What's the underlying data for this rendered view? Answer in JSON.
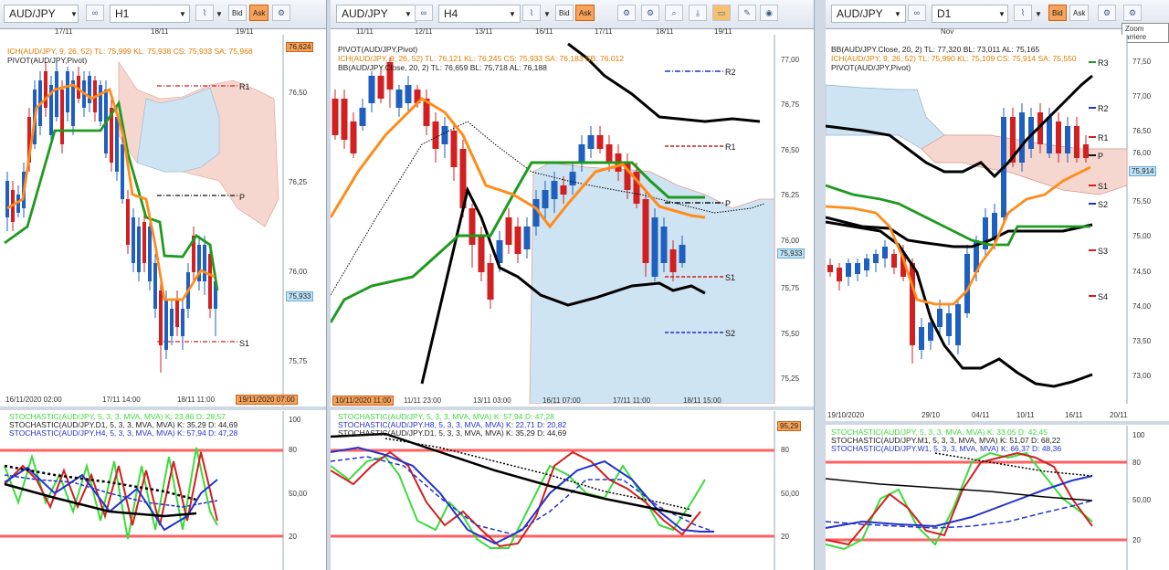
{
  "panels": [
    {
      "symbol": "AUD/JPY",
      "timeframe": "H1",
      "bid_label": "Bid",
      "ask_label": "Ask",
      "indicators": [
        {
          "text": "ICH(AUD/JPY, 9, 26, 52)  TL: 75,999  KL: 75,938  CS: 75,933  SA: 75,968",
          "color": "#e07b00"
        },
        {
          "text": "PIVOT(AUD/JPY,Pivot)",
          "color": "#222222"
        }
      ],
      "top_dates": [
        "17/11",
        "18/11",
        "19/11"
      ],
      "price_labels": [
        "76,50",
        "76,25",
        "76,00",
        "75,75"
      ],
      "price_top_tag": "76,624",
      "current_price": "75,933",
      "pivot_labels": [
        "R1",
        "P",
        "S1"
      ],
      "bottom_dates": [
        "16/11/2020 02:00",
        "17/11 14:00",
        "18/11 11:00"
      ],
      "bottom_tag": "19/11/2020 07:00",
      "stoch_lines": [
        {
          "text": "STOCHASTIC(AUD/JPY, 5, 3, 3, MVA, MVA)   K: 23,86   D: 28,57",
          "color": "#3cdc3c"
        },
        {
          "text": "STOCHASTIC(AUD/JPY.D1, 5, 3, 3, MVA, MVA)   K: 35,29   D: 44,69",
          "color": "#222222"
        },
        {
          "text": "STOCHASTIC(AUD/JPY.H4, 5, 3, 3, MVA, MVA)   K: 57,94   D: 47,28",
          "color": "#2233cc"
        }
      ],
      "stoch_axis": [
        "100",
        "80",
        "50,00",
        "20"
      ]
    },
    {
      "symbol": "AUD/JPY",
      "timeframe": "H4",
      "bid_label": "Bid",
      "ask_label": "Ask",
      "indicators": [
        {
          "text": "PIVOT(AUD/JPY,Pivot)",
          "color": "#222222"
        },
        {
          "text": "ICH(AUD/JPY, 9, 26, 52)  TL: 76,121  KL: 76,245  CS: 75,933  SA: 76,183  SB: 76,012",
          "color": "#e07b00"
        },
        {
          "text": "BB(AUD/JPY.Close, 20, 2)  TL: 76,659  BL: 75,718  AL: 76,188",
          "color": "#222222"
        }
      ],
      "top_dates": [
        "11/11",
        "12/11",
        "13/11",
        "16/11",
        "17/11",
        "18/11",
        "19/11"
      ],
      "price_labels": [
        "77,00",
        "76,75",
        "76,50",
        "76,25",
        "76,00",
        "75,75",
        "75,50",
        "75,25"
      ],
      "current_price": "75,933",
      "pivot_labels": [
        "R2",
        "R1",
        "P",
        "S1",
        "S2"
      ],
      "bottom_dates": [
        "10/11/2020 11:00",
        "11/11 23:00",
        "13/11 03:00",
        "16/11 07:00",
        "17/11 11:00",
        "18/11 15:00"
      ],
      "stoch_lines": [
        {
          "text": "STOCHASTIC(AUD/JPY, 5, 3, 3, MVA, MVA)   K: 57,94   D: 47,28",
          "color": "#3cdc3c"
        },
        {
          "text": "STOCHASTIC(AUD/JPY.H8, 5, 3, 3, MVA, MVA)   K: 22,71   D: 20,82",
          "color": "#2233cc"
        },
        {
          "text": "STOCHASTIC(AUD/JPY.D1, 5, 3, 3, MVA, MVA)   K: 35,29   D: 44,69",
          "color": "#222222"
        }
      ],
      "stoch_top_tag": "95,29",
      "stoch_axis": [
        "100",
        "80",
        "50,00",
        "20"
      ]
    },
    {
      "symbol": "AUD/JPY",
      "timeframe": "D1",
      "bid_label": "Bid",
      "ask_label": "Ask",
      "indicators": [
        {
          "text": "BB(AUD/JPY.Close, 20, 2)  TL: 77,320  BL: 73,011  AL: 75,165",
          "color": "#222222"
        },
        {
          "text": "ICH(AUD/JPY, 9, 26, 52)  TL: 75,990  KL: 75,109  CS: 75,914  SA: 75,550",
          "color": "#e07b00"
        },
        {
          "text": "PIVOT(AUD/JPY,Pivot)",
          "color": "#222222"
        }
      ],
      "top_dates": [
        "Nov"
      ],
      "price_labels": [
        "77,50",
        "77,00",
        "76,50",
        "76,00",
        "75,50",
        "75,00",
        "74,50",
        "74,00",
        "73,50",
        "73,00"
      ],
      "current_price": "75,914",
      "pivot_labels": [
        "R3",
        "R2",
        "R1",
        "P",
        "S1",
        "S2",
        "S3",
        "S4"
      ],
      "bottom_dates": [
        "19/10/2020",
        "29/10",
        "04/11",
        "10/11",
        "16/11",
        "20/11"
      ],
      "stoch_lines": [
        {
          "text": "STOCHASTIC(AUD/JPY, 5, 3, 3, MVA, MVA)   K: 33,05   D: 42,45",
          "color": "#3cdc3c"
        },
        {
          "text": "STOCHASTIC(AUD/JPY.M1, 5, 3, 3, MVA, MVA)   K: 51,07   D: 68,22",
          "color": "#222222"
        },
        {
          "text": "STOCHASTIC(AUD/JPY.W1, 5, 3, 3, MVA, MVA)   K: 66,37   D: 48,36",
          "color": "#2233cc"
        }
      ],
      "stoch_axis": [
        "100",
        "80",
        "50,00",
        "20"
      ],
      "tooltip": "Zoom arriere"
    }
  ],
  "colors": {
    "bull": "#1f5fbf",
    "bear": "#d21f1f",
    "kumo_up": "#cfe4f2",
    "kumo_down": "#f6d7cf",
    "tenkan": "#ff8c1a",
    "kijun": "#1f9a1f",
    "bb": "#000000",
    "band": "#ff6060"
  }
}
